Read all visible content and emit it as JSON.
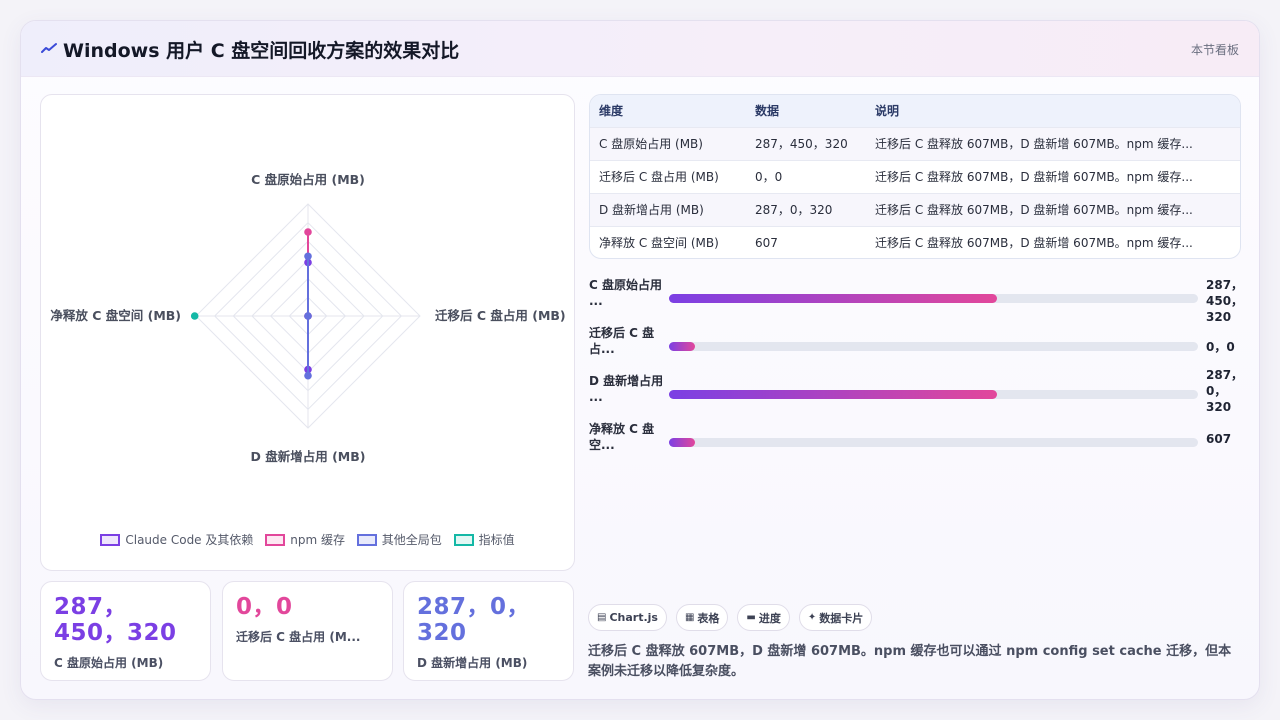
{
  "header": {
    "title": "Windows 用户 C 盘空间回收方案的效果对比",
    "badge": "本节看板"
  },
  "chart_data": {
    "type": "radar",
    "axes": [
      "C 盘原始占用 (MB)",
      "迁移后 C 盘占用 (MB)",
      "D 盘新增占用 (MB)",
      "净释放 C 盘空间 (MB)"
    ],
    "series": [
      {
        "name": "Claude Code 及其依赖",
        "values": [
          287,
          0,
          287,
          null
        ],
        "color": "#7b3fe4"
      },
      {
        "name": "npm 缓存",
        "values": [
          450,
          null,
          0,
          null
        ],
        "color": "#e2479b"
      },
      {
        "name": "其他全局包",
        "values": [
          320,
          0,
          320,
          null
        ],
        "color": "#6470dd"
      },
      {
        "name": "指标值",
        "values": [
          null,
          null,
          null,
          607
        ],
        "color": "#14b8a6"
      }
    ]
  },
  "table": {
    "headers": [
      "维度",
      "数据",
      "说明"
    ],
    "rows": [
      [
        "C 盘原始占用 (MB)",
        "287，450，320",
        "迁移后 C 盘释放 607MB，D 盘新增 607MB。npm 缓存..."
      ],
      [
        "迁移后 C 盘占用 (MB)",
        "0，0",
        "迁移后 C 盘释放 607MB，D 盘新增 607MB。npm 缓存..."
      ],
      [
        "D 盘新增占用 (MB)",
        "287，0，320",
        "迁移后 C 盘释放 607MB，D 盘新增 607MB。npm 缓存..."
      ],
      [
        "净释放 C 盘空间 (MB)",
        "607",
        "迁移后 C 盘释放 607MB，D 盘新增 607MB。npm 缓存..."
      ]
    ]
  },
  "progress": [
    {
      "label": "C 盘原始占用 ...",
      "value": "287，450，320",
      "fraction": 0.62
    },
    {
      "label": "迁移后 C 盘占...",
      "value": "0，0",
      "fraction": 0.05
    },
    {
      "label": "D 盘新增占用 ...",
      "value": "287，0，320",
      "fraction": 0.62
    },
    {
      "label": "净释放 C 盘空...",
      "value": "607",
      "fraction": 0.05
    }
  ],
  "stats": [
    {
      "value": "287，450，320",
      "label": "C 盘原始占用 (MB)",
      "color": "#7b3fe4"
    },
    {
      "value": "0，0",
      "label": "迁移后 C 盘占用 (M...",
      "color": "#e2479b"
    },
    {
      "value": "287，0，320",
      "label": "D 盘新增占用 (MB)",
      "color": "#6470dd"
    }
  ],
  "tags": [
    {
      "icon": "chart-icon",
      "label": "Chart.js"
    },
    {
      "icon": "table-icon",
      "label": "表格"
    },
    {
      "icon": "progress-icon",
      "label": "进度"
    },
    {
      "icon": "sparkle-icon",
      "label": "数据卡片"
    }
  ],
  "note": "迁移后 C 盘释放 607MB，D 盘新增 607MB。npm 缓存也可以通过 npm config set cache 迁移，但本案例未迁移以降低复杂度。"
}
